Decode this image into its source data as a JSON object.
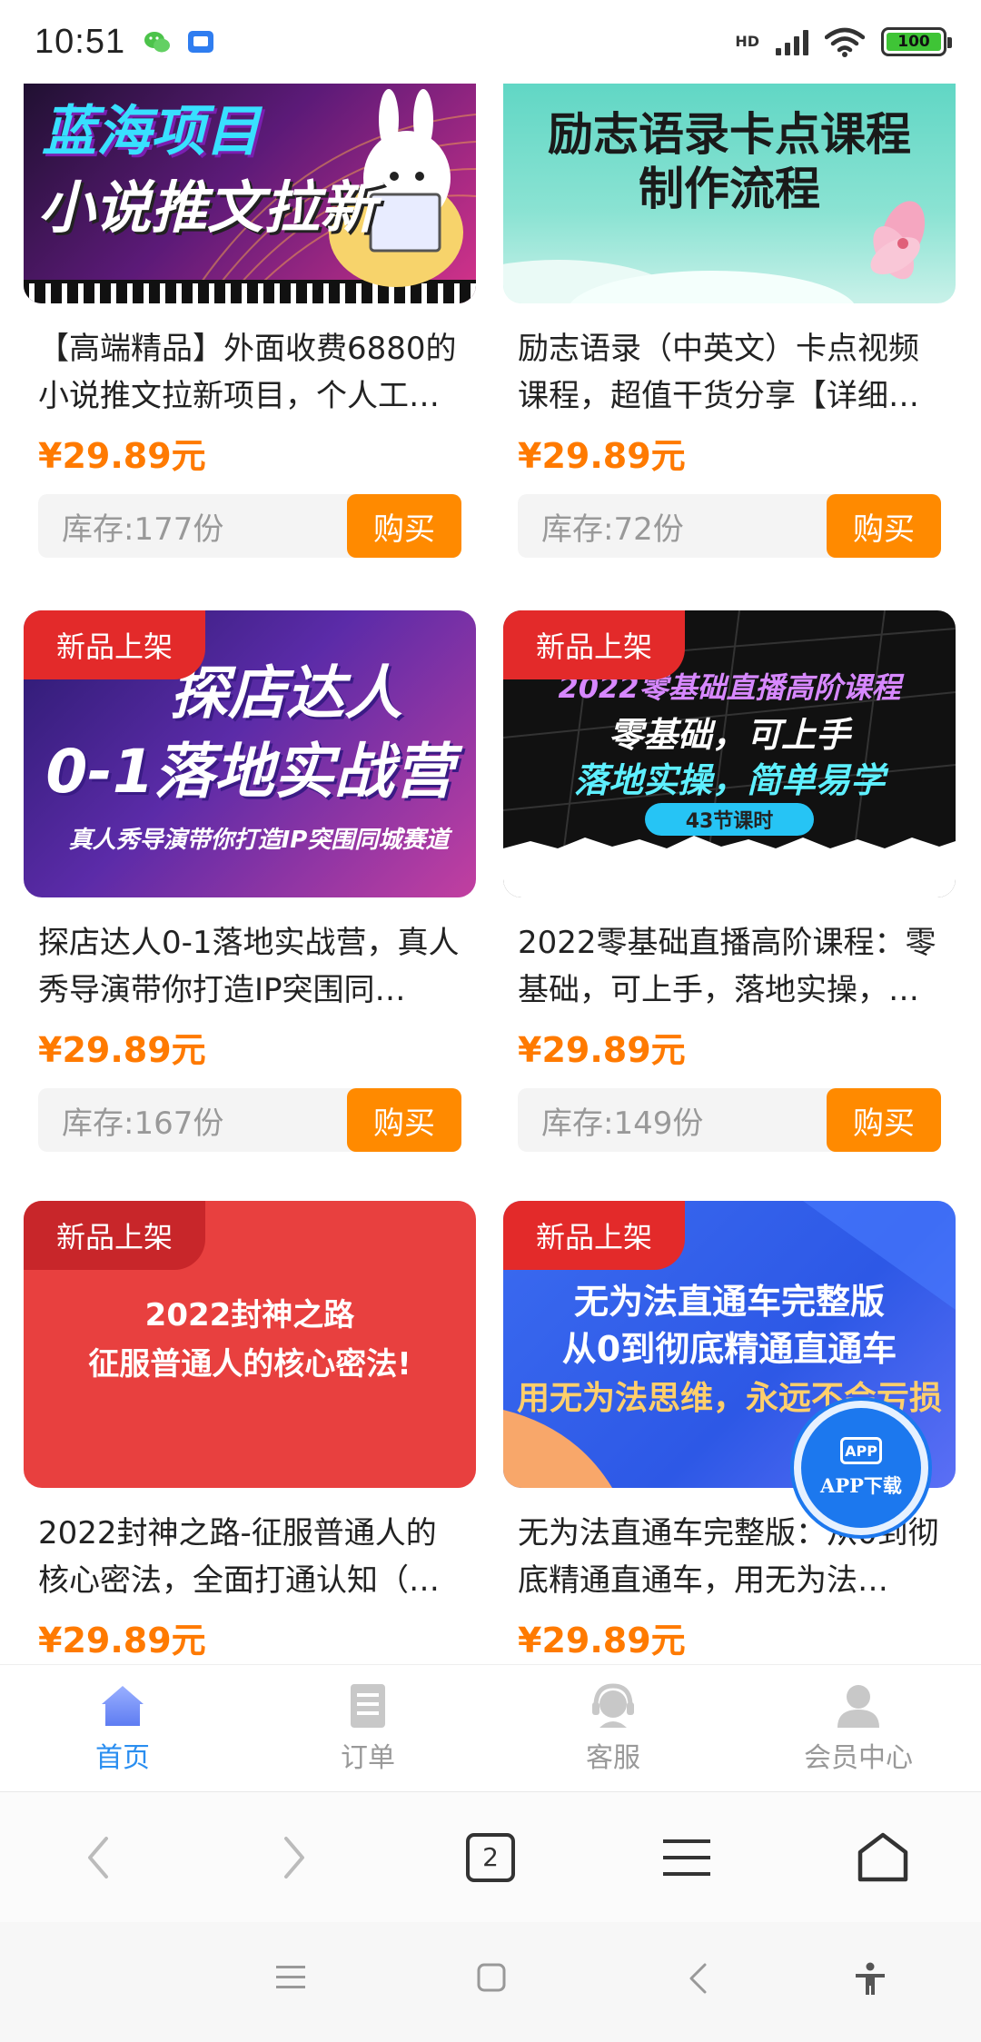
{
  "status_bar": {
    "time": "10:51",
    "network_label": "HD",
    "battery": "100",
    "icons": [
      "wechat-icon",
      "app-notification-icon",
      "signal-icon",
      "wifi-icon",
      "battery-icon"
    ]
  },
  "products": [
    {
      "banner_lines": [
        "蓝海项目",
        "小说推文拉新"
      ],
      "title_bold": "",
      "title": "【高端精品】外面收费6880的小说推文拉新项目，个人工…",
      "price": "¥29.89元",
      "stock": "库存:177份",
      "buy": "购买",
      "tag": ""
    },
    {
      "banner_lines": [
        "励志语录卡点课程",
        "制作流程"
      ],
      "title": "励志语录（中英文）卡点视频课程，超值干货分享【详细…",
      "price": "¥29.89元",
      "stock": "库存:72份",
      "buy": "购买",
      "tag": ""
    },
    {
      "banner_lines": [
        "探店达人",
        "0-1落地实战营",
        "真人秀导演带你打造IP突围同城赛道"
      ],
      "title": "探店达人0-1落地实战营，真人秀导演带你打造IP突围同…",
      "price": "¥29.89元",
      "stock": "库存:167份",
      "buy": "购买",
      "tag": "新品上架"
    },
    {
      "banner_lines": [
        "2022零基础直播高阶课程",
        "零基础，可上手",
        "落地实操，简单易学",
        "43节课时"
      ],
      "title": "2022零基础直播高阶课程：零基础，可上手，落地实操，…",
      "price": "¥29.89元",
      "stock": "库存:149份",
      "buy": "购买",
      "tag": "新品上架"
    },
    {
      "banner_lines": [
        "2022封神之路",
        "征服普通人的核心密法!"
      ],
      "title": "2022封神之路-征服普通人的核心密法，全面打通认知（…",
      "price": "¥29.89元",
      "stock": "",
      "buy": "",
      "tag": "新品上架"
    },
    {
      "banner_lines": [
        "无为法直通车完整版",
        "从0到彻底精通直通车",
        "用无为法思维，永远不会亏损"
      ],
      "title": "无为法直通车完整版：从0到彻底精通直通车，用无为法…",
      "price": "¥29.89元",
      "stock": "",
      "buy": "",
      "tag": "新品上架"
    }
  ],
  "fab": {
    "badge": "APP",
    "label": "APP下载"
  },
  "tabbar": [
    {
      "label": "首页",
      "icon": "home-icon",
      "active": true
    },
    {
      "label": "订单",
      "icon": "order-icon",
      "active": false
    },
    {
      "label": "客服",
      "icon": "customer-service-icon",
      "active": false
    },
    {
      "label": "会员中心",
      "icon": "member-icon",
      "active": false
    }
  ],
  "browser": {
    "tab_count": "2"
  },
  "colors": {
    "accent_blue": "#2a8ef0",
    "price_orange": "#ff7a00",
    "buy_orange": "#ff8a00",
    "tag_red": "#e32a2a"
  }
}
